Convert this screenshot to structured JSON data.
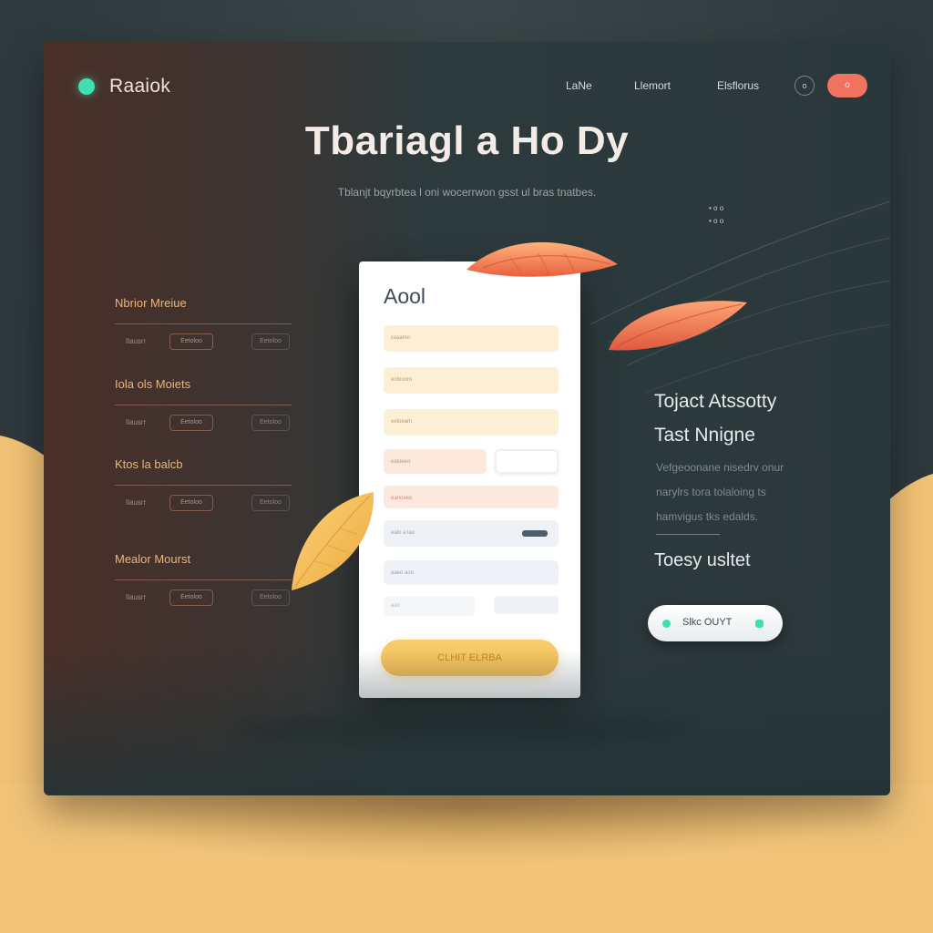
{
  "header": {
    "brand": "Raaiok",
    "nav": [
      "LaNe",
      "Llemort",
      "Elsflorus"
    ],
    "circle_button": "o",
    "pill_button": "o"
  },
  "hero": {
    "title": "Tbariagl a Ho Dy",
    "subtitle": "Tblanjt bqyrbtea l oni wocerrwon gsst ul bras tnatbes."
  },
  "side_note": [
    "• o o",
    "• o o"
  ],
  "left_panel": {
    "groups": [
      {
        "heading": "Nbrior Mreiue",
        "row": [
          "Ilausrr",
          "Eetoloo",
          "Eetoloo"
        ]
      },
      {
        "heading": "Iola ols Moiets",
        "row": [
          "Ilausrr",
          "Eetoloo",
          "Eetoloo"
        ]
      },
      {
        "heading": "Ktos la balcb",
        "row": [
          "Ilausrr",
          "Eetoloo",
          "Eetoloo"
        ]
      },
      {
        "heading": "Mealor Mourst",
        "row": [
          "Ilausrr",
          "Eetoloo",
          "Eetoloo"
        ]
      }
    ]
  },
  "form": {
    "title": "Aool",
    "fields": [
      {
        "placeholder": "cxaamo"
      },
      {
        "placeholder": "eolooom"
      },
      {
        "placeholder": "eeloeam"
      },
      {
        "placeholder": "ealoeeo"
      },
      {
        "placeholder": "eanoeeo"
      },
      {
        "placeholder": "ealo a lao"
      },
      {
        "placeholder": "aaeo aoo"
      },
      {
        "placeholder": "aao"
      }
    ],
    "submit": "CLHIT ELRBA"
  },
  "right_panel": {
    "title_line1": "Tojact Atssotty",
    "title_line2": "Tast Nnigne",
    "body": [
      "Vefgeoonane nisedrv onur",
      "narylrs tora tolaloing ts",
      "hamvigus tks edalds."
    ],
    "subtitle": "Toesy usltet",
    "cta": "Slkc OUYT"
  },
  "colors": {
    "accent_green": "#3fe0b0",
    "accent_coral": "#f0735f",
    "accent_yellow": "#f2bd55",
    "page_yellow": "#f2c479",
    "window_dark": "#2b383b"
  }
}
